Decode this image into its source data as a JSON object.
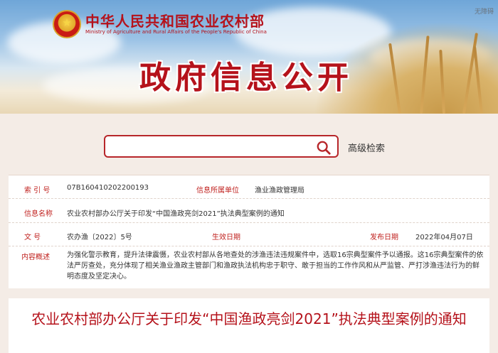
{
  "header": {
    "ministry_cn": "中华人民共和国农业农村部",
    "ministry_en": "Ministry of Agriculture and Rural Affairs of the People's Republic of China",
    "accessible": "无障碍",
    "section_title": "政府信息公开"
  },
  "search": {
    "placeholder": "",
    "value": "",
    "advanced_label": "高级检索"
  },
  "info": {
    "index_label": "索 引 号",
    "index_value": "07B160410202200193",
    "unit_label": "信息所属单位",
    "unit_value": "渔业渔政管理局",
    "name_label": "信息名称",
    "name_value": "农业农村部办公厅关于印发“中国渔政亮剑2021”执法典型案例的通知",
    "docno_label": "文  号",
    "docno_value": "农办渔〔2022〕5号",
    "effective_label": "生效日期",
    "effective_value": "",
    "publish_label": "发布日期",
    "publish_value": "2022年04月07日",
    "summary_label": "内容概述",
    "summary_value": "为强化警示教育，提升法律震慑，农业农村部从各地查处的涉渔违法违规案件中，选取16宗典型案件予以通报。这16宗典型案件的依法严厉查处，充分体现了相关渔业渔政主管部门和渔政执法机构忠于职守、敢于担当的工作作风和从严监管、严打涉渔违法行为的鲜明态度及坚定决心。"
  },
  "document": {
    "title": "农业农村部办公厅关于印发“中国渔政亮剑2021”执法典型案例的通知"
  },
  "colors": {
    "brand_red": "#b5121b",
    "label_red": "#c0221f",
    "page_bg": "#f4ece6"
  }
}
